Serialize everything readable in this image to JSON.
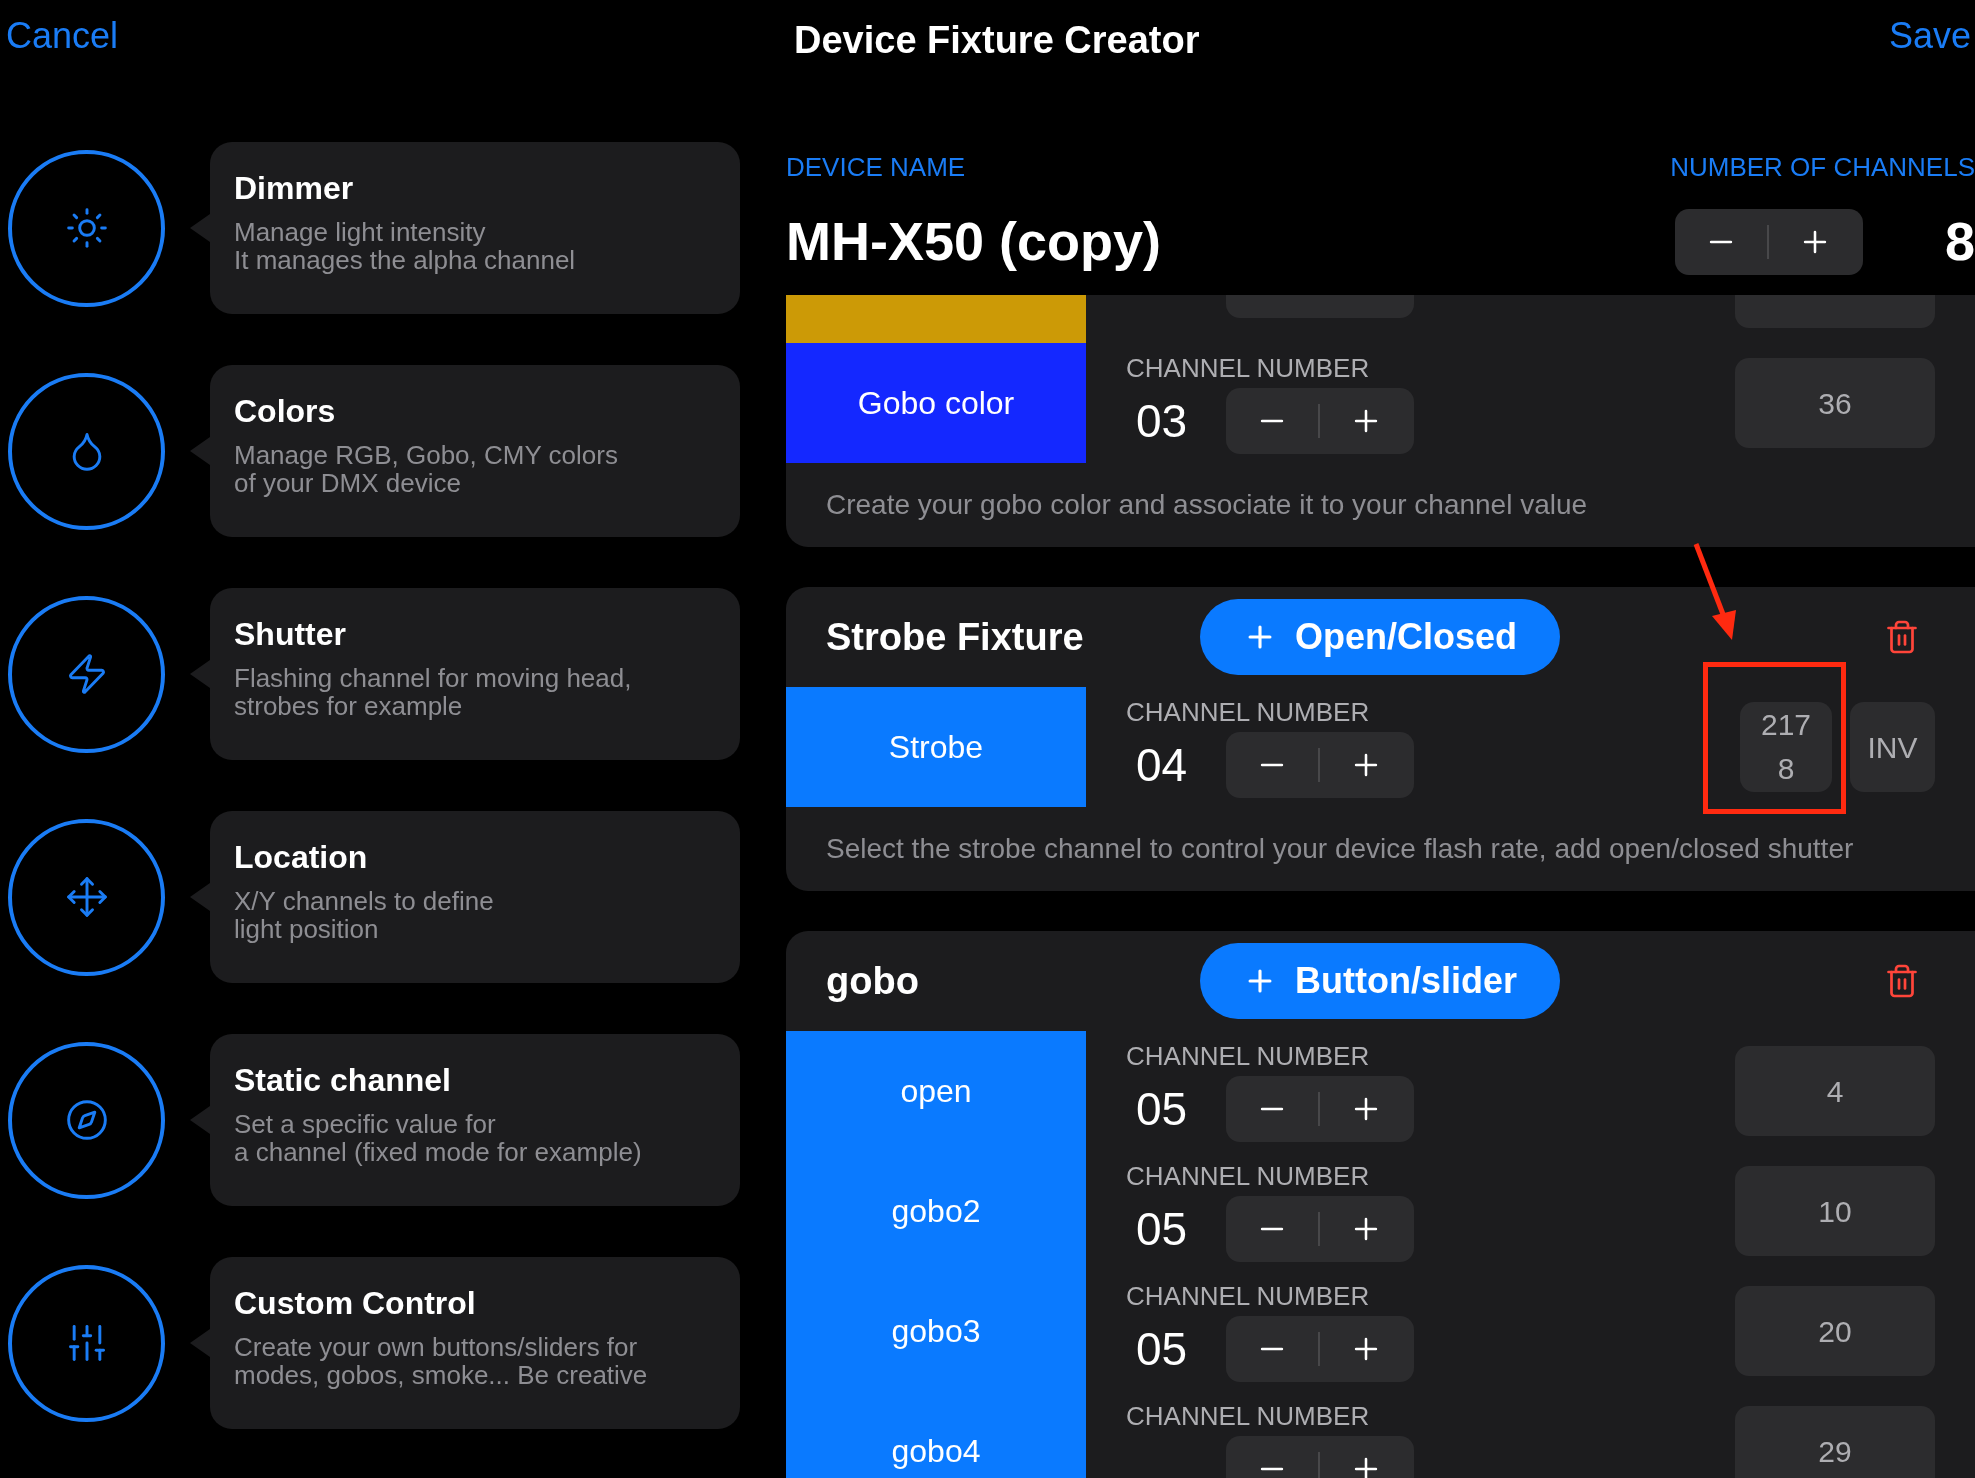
{
  "header": {
    "cancel": "Cancel",
    "title": "Device Fixture Creator",
    "save": "Save"
  },
  "tools": [
    {
      "kind": "sun",
      "title": "Dimmer",
      "lines": [
        "Manage light intensity",
        "It manages the alpha channel"
      ]
    },
    {
      "kind": "drop",
      "title": "Colors",
      "lines": [
        "Manage RGB, Gobo, CMY colors",
        "of your DMX device"
      ]
    },
    {
      "kind": "bolt",
      "title": "Shutter",
      "lines": [
        "Flashing channel for moving head,",
        "strobes for example"
      ]
    },
    {
      "kind": "move",
      "title": "Location",
      "lines": [
        "X/Y channels to define",
        "light position"
      ]
    },
    {
      "kind": "dial",
      "title": "Static channel",
      "lines": [
        "Set a specific value for",
        "a channel (fixed mode for example)"
      ]
    },
    {
      "kind": "sliders",
      "title": "Custom Control",
      "lines": [
        "Create your own buttons/sliders for",
        "modes, gobos, smoke... Be creative"
      ]
    }
  ],
  "device": {
    "name_label": "DEVICE NAME",
    "name": "MH-X50 (copy)",
    "channels_label": "NUMBER OF CHANNELS",
    "channels": "8"
  },
  "fixtures": [
    {
      "rows": [
        {
          "color": "#cc9a06"
        },
        {
          "color": "#1428ff",
          "label": "Gobo color",
          "channel_label": "CHANNEL NUMBER",
          "channel": "03",
          "value": "36"
        }
      ],
      "description": "Create your gobo color and associate it to your channel value"
    },
    {
      "title": "Strobe Fixture",
      "add": "Open/Closed",
      "rows": [
        {
          "color": "#0a7aff",
          "label": "Strobe",
          "channel_label": "CHANNEL NUMBER",
          "channel": "04",
          "value": "217",
          "value2": "8",
          "inv": "INV",
          "highlighted": true
        }
      ],
      "description": "Select the strobe channel to control your device flash rate, add open/closed shutter"
    },
    {
      "title": "gobo",
      "add": "Button/slider",
      "rows": [
        {
          "color": "#0a7aff",
          "label": "open",
          "channel_label": "CHANNEL NUMBER",
          "channel": "05",
          "value": "4"
        },
        {
          "color": "#0a7aff",
          "label": "gobo2",
          "channel_label": "CHANNEL NUMBER",
          "channel": "05",
          "value": "10"
        },
        {
          "color": "#0a7aff",
          "label": "gobo3",
          "channel_label": "CHANNEL NUMBER",
          "channel": "05",
          "value": "20"
        },
        {
          "color": "#0a7aff",
          "label": "gobo4",
          "channel_label": "CHANNEL NUMBER",
          "value": "29"
        }
      ]
    }
  ]
}
